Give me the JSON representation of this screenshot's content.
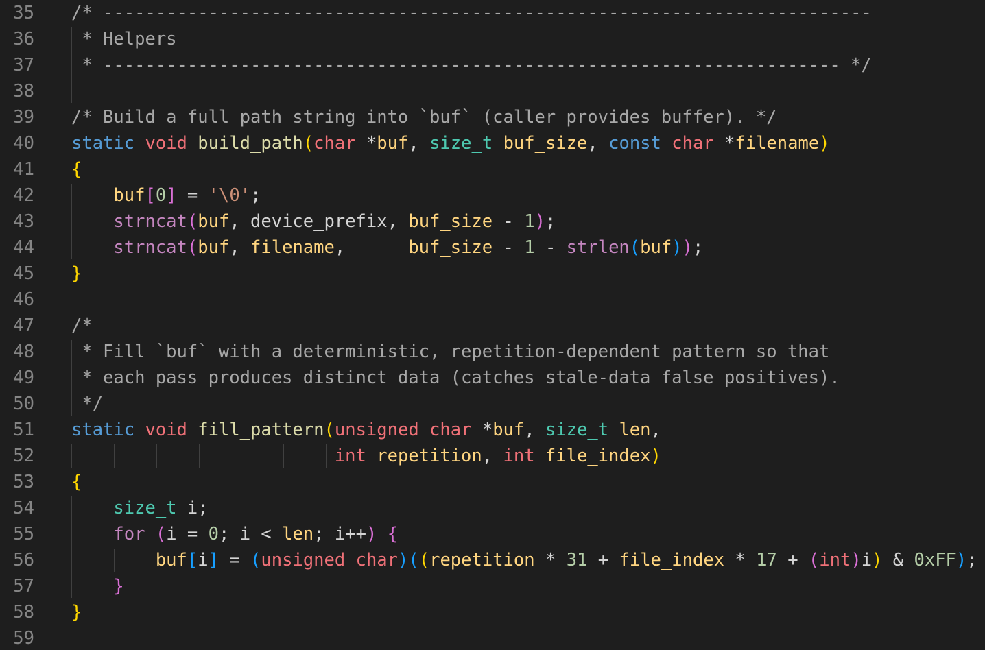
{
  "editor": {
    "colors": {
      "background": "#1e1e1e",
      "line_number": "#858585",
      "comment": "#a8a8a8",
      "keyword": "#569cd6",
      "type": "#f07178",
      "function": "#dcdcaa",
      "builtin_function": "#c586c0",
      "typedef": "#4ec9b0",
      "identifier": "#ffd580",
      "number": "#b5cea8",
      "string": "#ce9178",
      "bracket_level_1": "#ffd700",
      "bracket_level_2": "#da70d6",
      "bracket_level_3": "#179fff"
    },
    "lines": [
      {
        "num": "35",
        "tokens": [
          [
            "comment",
            "/* -------------------------------------------------------------------------"
          ]
        ]
      },
      {
        "num": "36",
        "tokens": [
          [
            "comment",
            " * Helpers"
          ]
        ]
      },
      {
        "num": "37",
        "tokens": [
          [
            "comment",
            " * ---------------------------------------------------------------------- */"
          ]
        ]
      },
      {
        "num": "38",
        "tokens": []
      },
      {
        "num": "39",
        "tokens": [
          [
            "comment",
            "/* Build a full path string into `buf` (caller provides buffer). */"
          ]
        ]
      },
      {
        "num": "40",
        "tokens": [
          [
            "kw",
            "static"
          ],
          [
            "plain",
            " "
          ],
          [
            "type",
            "void"
          ],
          [
            "plain",
            " "
          ],
          [
            "fn",
            "build_path"
          ],
          [
            "p1",
            "("
          ],
          [
            "type",
            "char"
          ],
          [
            "plain",
            " "
          ],
          [
            "op",
            "*"
          ],
          [
            "var",
            "buf"
          ],
          [
            "plain",
            ", "
          ],
          [
            "typedef",
            "size_t"
          ],
          [
            "plain",
            " "
          ],
          [
            "var",
            "buf_size"
          ],
          [
            "plain",
            ", "
          ],
          [
            "kw",
            "const"
          ],
          [
            "plain",
            " "
          ],
          [
            "type",
            "char"
          ],
          [
            "plain",
            " "
          ],
          [
            "op",
            "*"
          ],
          [
            "var",
            "filename"
          ],
          [
            "p1",
            ")"
          ]
        ]
      },
      {
        "num": "41",
        "tokens": [
          [
            "p1",
            "{"
          ]
        ]
      },
      {
        "num": "42",
        "tokens": [
          [
            "plain",
            "    "
          ],
          [
            "var",
            "buf"
          ],
          [
            "p2",
            "["
          ],
          [
            "num",
            "0"
          ],
          [
            "p2",
            "]"
          ],
          [
            "plain",
            " "
          ],
          [
            "op",
            "="
          ],
          [
            "plain",
            " "
          ],
          [
            "str",
            "'\\0'"
          ],
          [
            "plain",
            ";"
          ]
        ]
      },
      {
        "num": "43",
        "tokens": [
          [
            "plain",
            "    "
          ],
          [
            "builtin",
            "strncat"
          ],
          [
            "p2",
            "("
          ],
          [
            "var",
            "buf"
          ],
          [
            "plain",
            ", "
          ],
          [
            "plain",
            "device_prefix"
          ],
          [
            "plain",
            ", "
          ],
          [
            "var",
            "buf_size"
          ],
          [
            "plain",
            " "
          ],
          [
            "op",
            "-"
          ],
          [
            "plain",
            " "
          ],
          [
            "num",
            "1"
          ],
          [
            "p2",
            ")"
          ],
          [
            "plain",
            ";"
          ]
        ]
      },
      {
        "num": "44",
        "tokens": [
          [
            "plain",
            "    "
          ],
          [
            "builtin",
            "strncat"
          ],
          [
            "p2",
            "("
          ],
          [
            "var",
            "buf"
          ],
          [
            "plain",
            ", "
          ],
          [
            "var",
            "filename"
          ],
          [
            "plain",
            ",      "
          ],
          [
            "var",
            "buf_size"
          ],
          [
            "plain",
            " "
          ],
          [
            "op",
            "-"
          ],
          [
            "plain",
            " "
          ],
          [
            "num",
            "1"
          ],
          [
            "plain",
            " "
          ],
          [
            "op",
            "-"
          ],
          [
            "plain",
            " "
          ],
          [
            "builtin",
            "strlen"
          ],
          [
            "p3",
            "("
          ],
          [
            "var",
            "buf"
          ],
          [
            "p3",
            ")"
          ],
          [
            "p2",
            ")"
          ],
          [
            "plain",
            ";"
          ]
        ]
      },
      {
        "num": "45",
        "tokens": [
          [
            "p1",
            "}"
          ]
        ]
      },
      {
        "num": "46",
        "tokens": []
      },
      {
        "num": "47",
        "tokens": [
          [
            "comment",
            "/*"
          ]
        ]
      },
      {
        "num": "48",
        "tokens": [
          [
            "comment",
            " * Fill `buf` with a deterministic, repetition-dependent pattern so that"
          ]
        ]
      },
      {
        "num": "49",
        "tokens": [
          [
            "comment",
            " * each pass produces distinct data (catches stale-data false positives)."
          ]
        ]
      },
      {
        "num": "50",
        "tokens": [
          [
            "comment",
            " */"
          ]
        ]
      },
      {
        "num": "51",
        "tokens": [
          [
            "kw",
            "static"
          ],
          [
            "plain",
            " "
          ],
          [
            "type",
            "void"
          ],
          [
            "plain",
            " "
          ],
          [
            "fn",
            "fill_pattern"
          ],
          [
            "p1",
            "("
          ],
          [
            "type",
            "unsigned"
          ],
          [
            "plain",
            " "
          ],
          [
            "type",
            "char"
          ],
          [
            "plain",
            " "
          ],
          [
            "op",
            "*"
          ],
          [
            "var",
            "buf"
          ],
          [
            "plain",
            ", "
          ],
          [
            "typedef",
            "size_t"
          ],
          [
            "plain",
            " "
          ],
          [
            "var",
            "len"
          ],
          [
            "plain",
            ","
          ]
        ]
      },
      {
        "num": "52",
        "tokens": [
          [
            "plain",
            "                         "
          ],
          [
            "type",
            "int"
          ],
          [
            "plain",
            " "
          ],
          [
            "var",
            "repetition"
          ],
          [
            "plain",
            ", "
          ],
          [
            "type",
            "int"
          ],
          [
            "plain",
            " "
          ],
          [
            "var",
            "file_index"
          ],
          [
            "p1",
            ")"
          ]
        ]
      },
      {
        "num": "53",
        "tokens": [
          [
            "p1",
            "{"
          ]
        ]
      },
      {
        "num": "54",
        "tokens": [
          [
            "plain",
            "    "
          ],
          [
            "typedef",
            "size_t"
          ],
          [
            "plain",
            " i;"
          ]
        ]
      },
      {
        "num": "55",
        "tokens": [
          [
            "plain",
            "    "
          ],
          [
            "builtin",
            "for"
          ],
          [
            "plain",
            " "
          ],
          [
            "p2",
            "("
          ],
          [
            "plain",
            "i "
          ],
          [
            "op",
            "="
          ],
          [
            "plain",
            " "
          ],
          [
            "num",
            "0"
          ],
          [
            "plain",
            "; i "
          ],
          [
            "op",
            "<"
          ],
          [
            "plain",
            " "
          ],
          [
            "var",
            "len"
          ],
          [
            "plain",
            "; i++"
          ],
          [
            "p2",
            ")"
          ],
          [
            "plain",
            " "
          ],
          [
            "p2",
            "{"
          ]
        ]
      },
      {
        "num": "56",
        "tokens": [
          [
            "plain",
            "        "
          ],
          [
            "var",
            "buf"
          ],
          [
            "p3",
            "["
          ],
          [
            "plain",
            "i"
          ],
          [
            "p3",
            "]"
          ],
          [
            "plain",
            " "
          ],
          [
            "op",
            "="
          ],
          [
            "plain",
            " "
          ],
          [
            "p3",
            "("
          ],
          [
            "type",
            "unsigned"
          ],
          [
            "plain",
            " "
          ],
          [
            "type",
            "char"
          ],
          [
            "p3",
            ")"
          ],
          [
            "p3",
            "("
          ],
          [
            "p1",
            "("
          ],
          [
            "var",
            "repetition"
          ],
          [
            "plain",
            " "
          ],
          [
            "op",
            "*"
          ],
          [
            "plain",
            " "
          ],
          [
            "num",
            "31"
          ],
          [
            "plain",
            " "
          ],
          [
            "op",
            "+"
          ],
          [
            "plain",
            " "
          ],
          [
            "var",
            "file_index"
          ],
          [
            "plain",
            " "
          ],
          [
            "op",
            "*"
          ],
          [
            "plain",
            " "
          ],
          [
            "num",
            "17"
          ],
          [
            "plain",
            " "
          ],
          [
            "op",
            "+"
          ],
          [
            "plain",
            " "
          ],
          [
            "p2",
            "("
          ],
          [
            "type",
            "int"
          ],
          [
            "p2",
            ")"
          ],
          [
            "plain",
            "i"
          ],
          [
            "p1",
            ")"
          ],
          [
            "plain",
            " "
          ],
          [
            "op",
            "&"
          ],
          [
            "plain",
            " "
          ],
          [
            "num",
            "0xFF"
          ],
          [
            "p3",
            ")"
          ],
          [
            "plain",
            ";"
          ]
        ]
      },
      {
        "num": "57",
        "tokens": [
          [
            "plain",
            "    "
          ],
          [
            "p2",
            "}"
          ]
        ]
      },
      {
        "num": "58",
        "tokens": [
          [
            "p1",
            "}"
          ]
        ]
      },
      {
        "num": "59",
        "tokens": []
      }
    ]
  }
}
